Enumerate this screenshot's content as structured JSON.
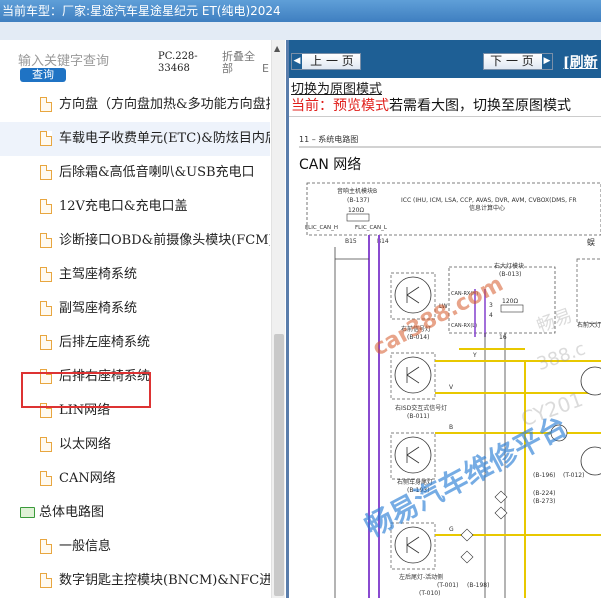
{
  "header": {
    "current_model_label": "当前车型：",
    "current_model_value": "厂家:星途汽车星途星纪元 ET(纯电)2024"
  },
  "search": {
    "placeholder": "输入关键字查询",
    "button_label": "查询",
    "code": "PC.228-33468",
    "collapse_all": "折叠全部",
    "truncated": "E"
  },
  "tree": {
    "items": [
      {
        "label": "方向盘（方向盘加热&多功能方向盘按",
        "type": "doc"
      },
      {
        "label": "车载电子收费单元(ETC)&防炫目内后",
        "type": "doc"
      },
      {
        "label": "后除霜&高低音喇叭&USB充电口",
        "type": "doc"
      },
      {
        "label": "12V充电口&充电口盖",
        "type": "doc"
      },
      {
        "label": "诊断接口OBD&前摄像头模块(FCM)",
        "type": "doc"
      },
      {
        "label": "主驾座椅系统",
        "type": "doc"
      },
      {
        "label": "副驾座椅系统",
        "type": "doc"
      },
      {
        "label": "后排左座椅系统",
        "type": "doc"
      },
      {
        "label": "后排右座椅系统",
        "type": "doc"
      },
      {
        "label": "LIN网络",
        "type": "doc"
      },
      {
        "label": "以太网络",
        "type": "doc"
      },
      {
        "label": "CAN网络",
        "type": "doc"
      },
      {
        "label": "总体电路图",
        "type": "folder"
      },
      {
        "label": "一般信息",
        "type": "doc"
      },
      {
        "label": "数字钥匙主控模块(BNCM)&NFC进入",
        "type": "doc"
      }
    ]
  },
  "nav": {
    "prev_label": "上 一 页",
    "next_label": "下 一 页",
    "refresh_label": "[刷新"
  },
  "preview": {
    "switch_link": "切换为原图模式",
    "mode_prefix": "当前：预览模式",
    "mode_suffix": "若需看大图，切换至原图模式"
  },
  "diagram": {
    "section": "11 – 系统电路图",
    "title": "CAN 网络",
    "host_module": "音响主机模块B",
    "host_connector": "(B-137)",
    "bus_modules": "ICC (IHU, ICM, LSA, CCP, AVAS, DVR, AVM, CVBOX(DMS, FR",
    "bus_modules_2": "信息计算中心",
    "resistor": "120Ω",
    "can_h": "FLIC_CAN_H",
    "can_l": "FLIC_CAN_L",
    "pin_b15": "B15",
    "pin_b14": "B14",
    "right_lamp": "右大灯模块",
    "right_lamp_conn": "(B-013)",
    "right_sensor": "右前信号灯",
    "right_sensor_conn": "(B-014)",
    "right_drl": "右ISD交互式信号灯",
    "right_drl_conn": "(B-011)",
    "right_rear_sensor": "右侧车身尾灯",
    "right_rear_sensor_conn": "(B-193)",
    "left_rear_lamp": "左后尾灯-活动侧",
    "left_rear_lamp_conn": "(T-001)",
    "far_right_label": "蜈",
    "far_right_module": "右前大灯",
    "wire_lw": "LW",
    "wire_y": "Y",
    "wire_v": "V",
    "wire_b": "B",
    "wire_g": "G",
    "conn_b196": "(B-196)",
    "conn_t012": "(T-012)",
    "conn_b224": "(B-224)",
    "conn_b273": "(B-273)",
    "conn_b198": "(B-198)",
    "conn_t010": "(T-010)",
    "can_rx_h": "CAN-RX(H)",
    "can_rx_l": "CAN-RX(L)",
    "pin_16": "16",
    "pin_3": "3",
    "pin_4": "4"
  },
  "watermark": {
    "site": "car388.com",
    "platform": "畅易汽车维修平台",
    "faint": "CY201",
    "faint2": "388.c",
    "faint3": "畅易"
  },
  "colors": {
    "highlight_border": "#dd3333",
    "nav_bar": "#1e5f95",
    "mode_red": "#e0201c",
    "query_button": "#1f73c4"
  }
}
